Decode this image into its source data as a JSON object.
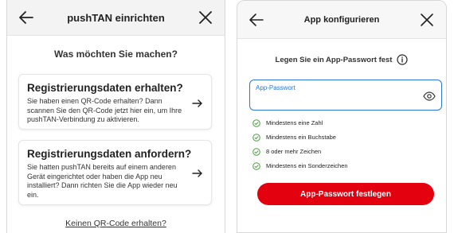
{
  "colors": {
    "accent": "#e3000f",
    "field_focus": "#2b78d6",
    "check": "#4a9d3f"
  },
  "left": {
    "title": "pushTAN einrichten",
    "back_icon": "arrow-left-icon",
    "close_icon": "close-icon",
    "question": "Was möchten Sie machen?",
    "cards": [
      {
        "title": "Registrierungsdaten erhalten?",
        "text": "Sie haben einen QR-Code erhalten? Dann scannen Sie den QR-Code jetzt hier ein, um Ihre pushTAN-Verbindung zu aktivieren.",
        "icon": "arrow-right-icon"
      },
      {
        "title": "Registrierungsdaten anfordern?",
        "text": "Sie hatten pushTAN bereits auf einem anderen Gerät eingerichtet oder haben die App neu installiert? Dann richten Sie die App wieder neu ein.",
        "icon": "arrow-right-icon"
      }
    ],
    "link": "Keinen QR-Code erhalten?"
  },
  "right": {
    "title": "App konfigurieren",
    "back_icon": "arrow-left-icon",
    "close_icon": "close-icon",
    "info_text": "Legen Sie ein App-Passwort fest",
    "info_icon": "info-icon",
    "password_field": {
      "label": "App-Passwort",
      "value": "",
      "toggle_icon": "eye-icon"
    },
    "requirements": [
      "Mindestens eine Zahl",
      "Mindestens ein Buchstabe",
      "8 oder mehr Zeichen",
      "Mindestens ein Sonderzeichen"
    ],
    "button": "App-Passwort festlegen"
  }
}
